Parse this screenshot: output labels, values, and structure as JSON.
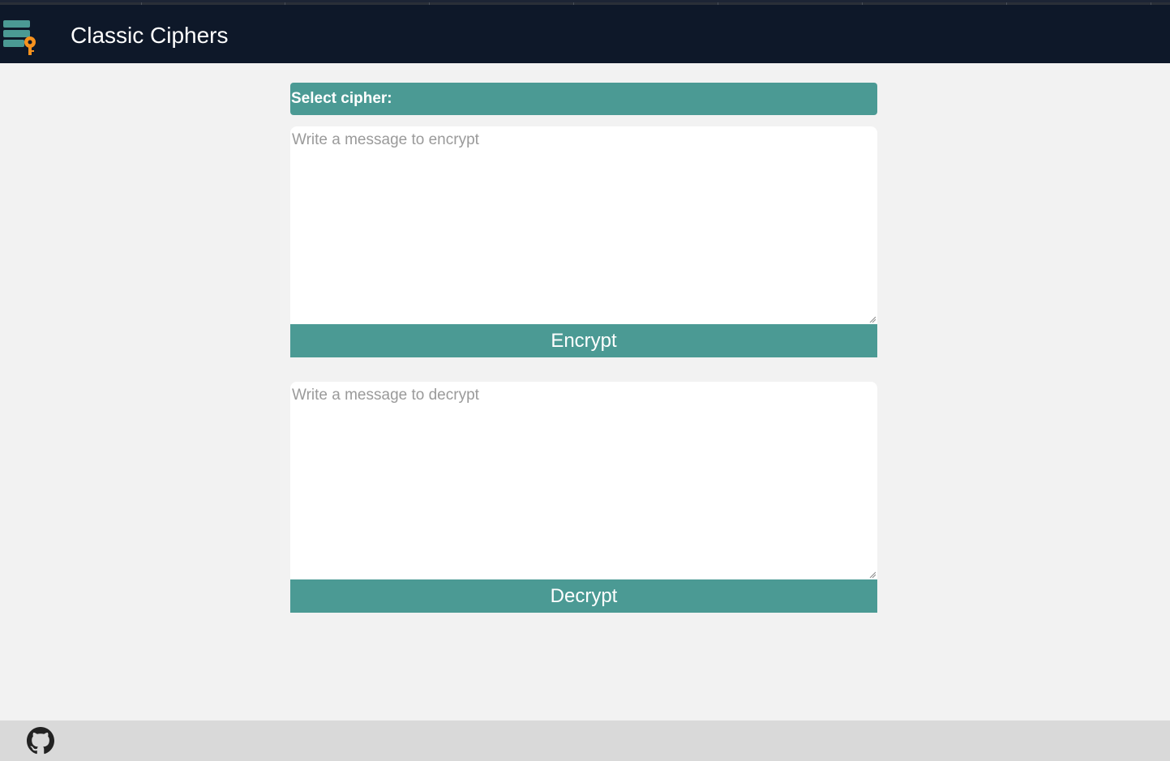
{
  "header": {
    "title": "Classic Ciphers",
    "logo_icon": "cipher-key-logo-icon"
  },
  "cipher_select": {
    "label": "Select cipher:"
  },
  "encrypt": {
    "placeholder": "Write a message to encrypt",
    "button_label": "Encrypt"
  },
  "decrypt": {
    "placeholder": "Write a message to decrypt",
    "button_label": "Decrypt"
  },
  "footer": {
    "link_icon": "github-icon"
  },
  "colors": {
    "header_bg": "#0e1829",
    "accent": "#4b9a94",
    "key_orange": "#f7921e",
    "page_bg": "#f2f2f2",
    "footer_bg": "#d9d9d9"
  }
}
